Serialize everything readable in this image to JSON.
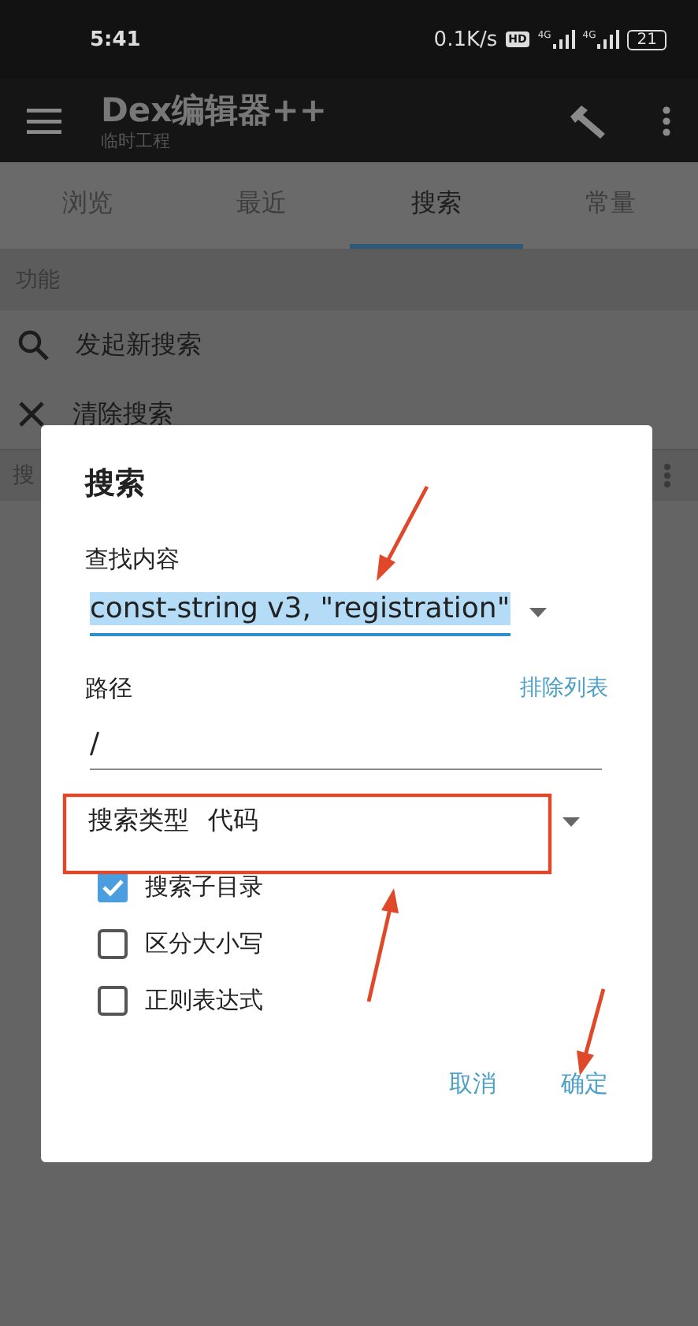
{
  "status_bar": {
    "time": "5:41",
    "speed": "0.1K/s",
    "hd": "HD",
    "networks": [
      {
        "label": "4G"
      },
      {
        "label": "4G"
      }
    ],
    "battery": "21"
  },
  "app_bar": {
    "title": "Dex编辑器++",
    "subtitle": "临时工程"
  },
  "tabs": [
    {
      "label": "浏览",
      "selected": false
    },
    {
      "label": "最近",
      "selected": false
    },
    {
      "label": "搜索",
      "selected": true
    },
    {
      "label": "常量",
      "selected": false
    }
  ],
  "section": {
    "header": "功能",
    "items": [
      {
        "kind": "search",
        "label": "发起新搜索"
      },
      {
        "kind": "clear",
        "label": "清除搜索"
      }
    ]
  },
  "results_header": {
    "label": "搜"
  },
  "dialog": {
    "title": "搜索",
    "query_label": "查找内容",
    "query_value": "const-string v3, \"registration\"",
    "query_selected": true,
    "path_label": "路径",
    "exclude_link": "排除列表",
    "path_value": "/",
    "type_label": "搜索类型",
    "type_value": "代码",
    "options": [
      {
        "label": "搜索子目录",
        "checked": true
      },
      {
        "label": "区分大小写",
        "checked": false
      },
      {
        "label": "正则表达式",
        "checked": false
      }
    ],
    "buttons": [
      "取消",
      "确定"
    ]
  }
}
